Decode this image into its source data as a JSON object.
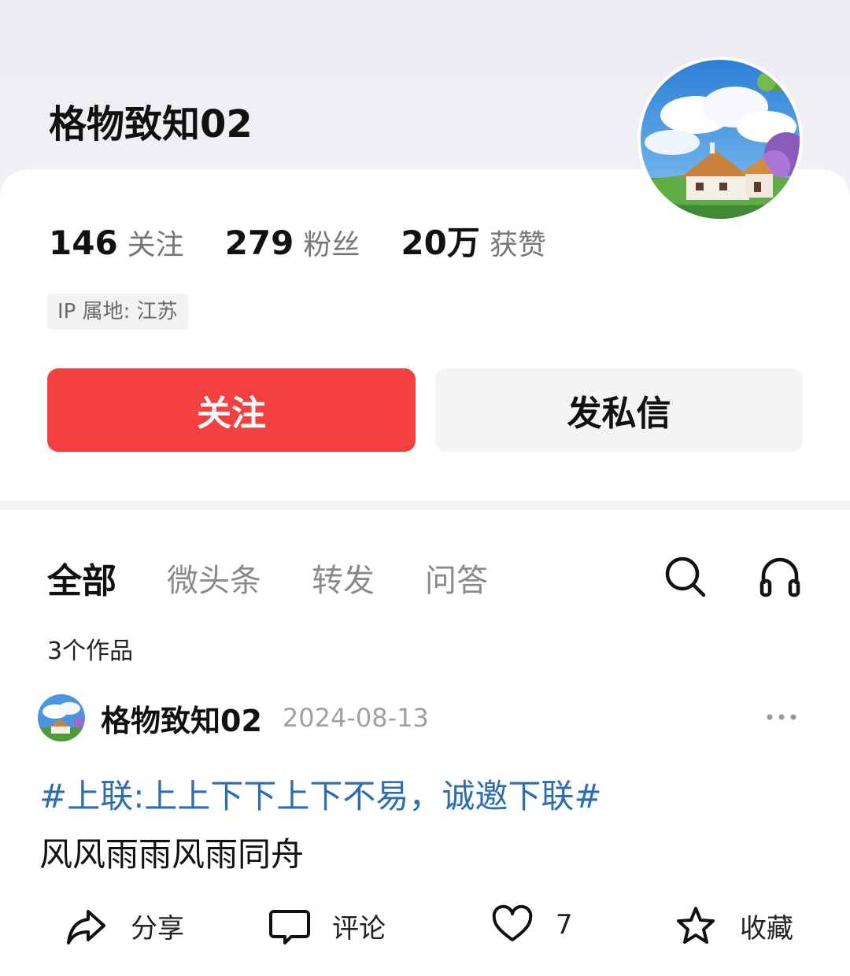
{
  "profile": {
    "name": "格物致知02",
    "stats": [
      {
        "value": "146",
        "label": "关注"
      },
      {
        "value": "279",
        "label": "粉丝"
      },
      {
        "value": "20万",
        "label": "获赞"
      }
    ],
    "ip_location": "IP 属地: 江苏",
    "follow_button": "关注",
    "message_button": "发私信"
  },
  "tabs": {
    "all": "全部",
    "micro": "微头条",
    "repost": "转发",
    "qa": "问答",
    "search_icon": "search-icon",
    "listen_icon": "headphones-icon"
  },
  "works_count": "3个作品",
  "post": {
    "author": "格物致知02",
    "date": "2024-08-13",
    "topic": "#上联:上上下下上下不易，诚邀下联#",
    "body": "风风雨雨风雨同舟",
    "actions": {
      "share": "分享",
      "comment": "评论",
      "likes": "7",
      "favorite": "收藏"
    }
  },
  "colors": {
    "accent": "#f4403f",
    "topic": "#2c6eb0"
  }
}
